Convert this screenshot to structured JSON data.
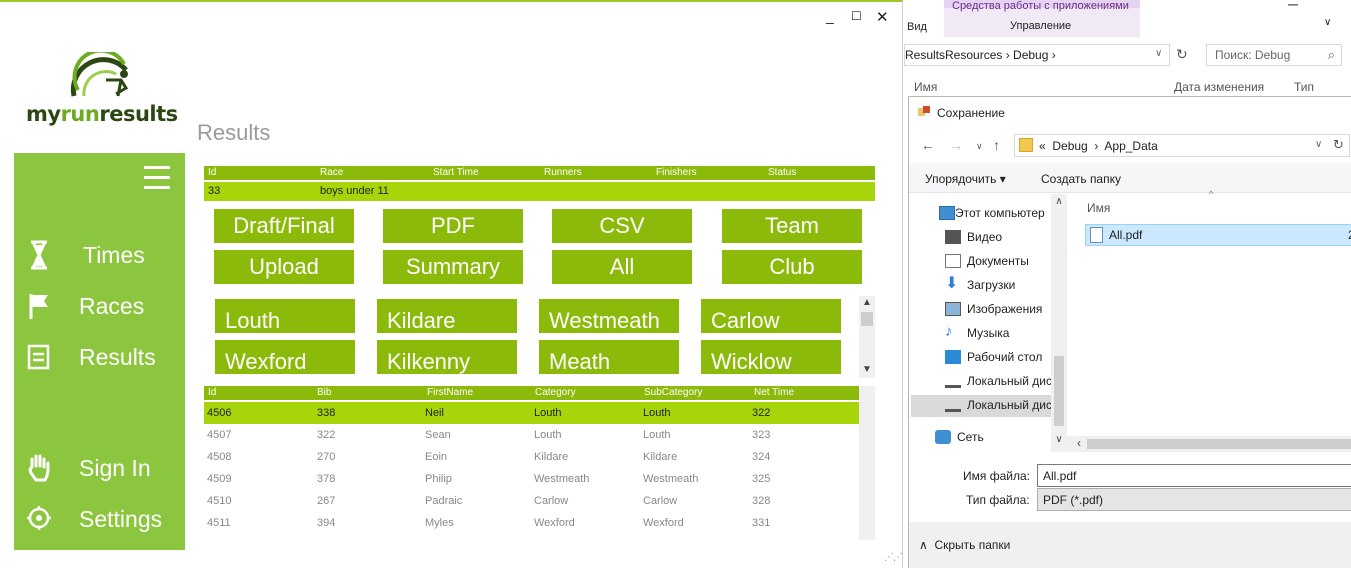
{
  "app": {
    "logo": {
      "part1": "my",
      "part2": "run",
      "part3": "results"
    },
    "page_title": "Results",
    "sidebar": {
      "items": [
        {
          "label": "Times",
          "icon": "hourglass-icon"
        },
        {
          "label": "Races",
          "icon": "flag-icon"
        },
        {
          "label": "Results",
          "icon": "list-icon"
        },
        {
          "label": "Sign In",
          "icon": "hand-icon"
        },
        {
          "label": "Settings",
          "icon": "gear-icon"
        }
      ]
    },
    "race_grid": {
      "headers": [
        "Id",
        "Race",
        "Start Time",
        "Runners",
        "Finishers",
        "Status"
      ],
      "rows": [
        [
          "33",
          "boys under 11",
          "",
          "",
          "",
          ""
        ]
      ]
    },
    "buttons": [
      "Draft/Final",
      "PDF",
      "CSV",
      "Team",
      "Upload",
      "Summary",
      "All",
      "Club"
    ],
    "counties": [
      "Louth",
      "Kildare",
      "Westmeath",
      "Carlow",
      "Wexford",
      "Kilkenny",
      "Meath",
      "Wicklow"
    ],
    "results_grid": {
      "headers": [
        "Id",
        "Bib",
        "FirstName",
        "Category",
        "SubCategory",
        "Net Time"
      ],
      "rows": [
        [
          "4506",
          "338",
          "Neil",
          "Louth",
          "Louth",
          "322"
        ],
        [
          "4507",
          "322",
          "Sean",
          "Louth",
          "Louth",
          "323"
        ],
        [
          "4508",
          "270",
          "Eoin",
          "Kildare",
          "Kildare",
          "324"
        ],
        [
          "4509",
          "378",
          "Philip",
          "Westmeath",
          "Westmeath",
          "325"
        ],
        [
          "4510",
          "267",
          "Padraic",
          "Carlow",
          "Carlow",
          "328"
        ],
        [
          "4511",
          "394",
          "Myles",
          "Wexford",
          "Wexford",
          "331"
        ]
      ]
    },
    "colors": {
      "accent": "#8cc63f",
      "grid_header": "#8cba0a",
      "selected_row": "#a6d60a"
    }
  },
  "explorer": {
    "ribbon": {
      "context_title": "Средства работы с приложениями",
      "tab_view": "Вид",
      "tab_manage": "Управление"
    },
    "address": {
      "path": [
        "ResultsResources",
        "Debug"
      ]
    },
    "search_placeholder": "Поиск: Debug",
    "columns": [
      "Имя",
      "Дата изменения",
      "Тип"
    ],
    "dialog": {
      "title": "Сохранение",
      "path": [
        "«",
        "Debug",
        "App_Data"
      ],
      "toolbar": {
        "organize": "Упорядочить",
        "new_folder": "Создать папку"
      },
      "tree": [
        {
          "label": "Этот компьютер",
          "icon": "computer-icon"
        },
        {
          "label": "Видео",
          "icon": "video-icon"
        },
        {
          "label": "Документы",
          "icon": "documents-icon"
        },
        {
          "label": "Загрузки",
          "icon": "downloads-icon"
        },
        {
          "label": "Изображения",
          "icon": "pictures-icon"
        },
        {
          "label": "Музыка",
          "icon": "music-icon"
        },
        {
          "label": "Рабочий стол",
          "icon": "desktop-icon"
        },
        {
          "label": "Локальный дис",
          "icon": "drive-icon"
        },
        {
          "label": "Локальный дис",
          "icon": "drive-icon"
        },
        {
          "label": "Сеть",
          "icon": "network-icon"
        }
      ],
      "file_column": "Имя",
      "files": [
        {
          "name": "All.pdf",
          "extra": "2"
        }
      ],
      "filename_label": "Имя файла:",
      "filename_value": "All.pdf",
      "filetype_label": "Тип файла:",
      "filetype_value": "PDF (*.pdf)",
      "hide_folders": "Скрыть папки"
    }
  }
}
